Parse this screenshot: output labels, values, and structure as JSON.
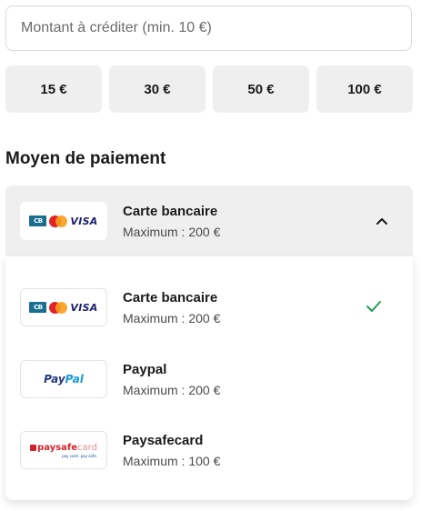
{
  "amount": {
    "placeholder": "Montant à créditer (min. 10 €)",
    "value": ""
  },
  "presets": [
    "15 €",
    "30 €",
    "50 €",
    "100 €"
  ],
  "payment_section": {
    "title": "Moyen de paiement",
    "selected": {
      "name": "Carte bancaire",
      "max": "Maximum : 200 €",
      "logo": "cb-mastercard-visa-logo",
      "expanded_icon": "chevron-up-icon"
    },
    "options": [
      {
        "name": "Carte bancaire",
        "max": "Maximum : 200 €",
        "logo": "cb-mastercard-visa-logo",
        "selected": true,
        "logo_text": {
          "cb": "CB",
          "visa": "VISA"
        }
      },
      {
        "name": "Paypal",
        "max": "Maximum : 200 €",
        "logo": "paypal-logo",
        "selected": false,
        "logo_text": {
          "part1": "Pay",
          "part2": "Pal"
        }
      },
      {
        "name": "Paysafecard",
        "max": "Maximum : 100 €",
        "logo": "paysafecard-logo",
        "selected": false,
        "logo_text": {
          "part1": "paysafe",
          "part2": "card",
          "tagline": "pay cash. pay safe."
        }
      }
    ]
  },
  "colors": {
    "check": "#1f9d55",
    "preset_bg": "#efefef",
    "paypal_dark": "#253b80",
    "paypal_light": "#179bd7",
    "paysafe_red": "#d2232a",
    "visa_blue": "#1a1f71"
  }
}
